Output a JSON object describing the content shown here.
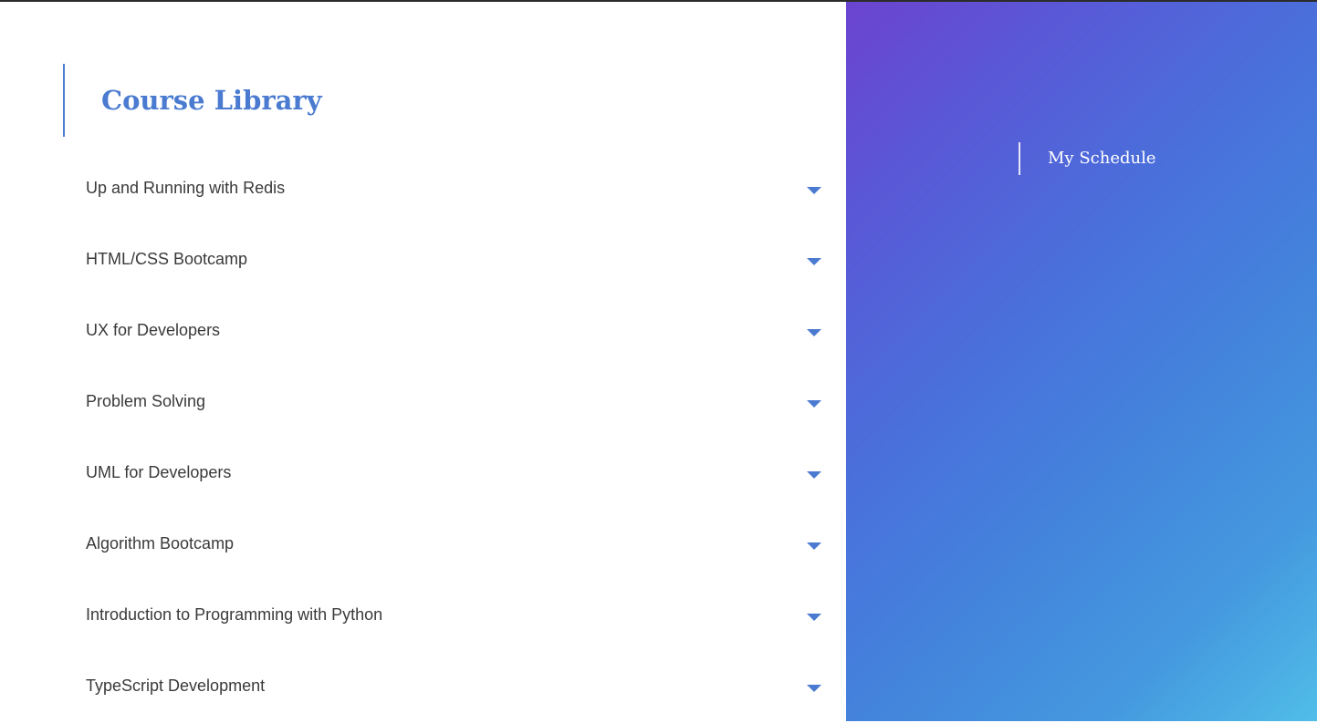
{
  "library": {
    "title": "Course Library",
    "courses": [
      {
        "label": "Up and Running with Redis"
      },
      {
        "label": "HTML/CSS Bootcamp"
      },
      {
        "label": "UX for Developers"
      },
      {
        "label": "Problem Solving"
      },
      {
        "label": "UML for Developers"
      },
      {
        "label": "Algorithm Bootcamp"
      },
      {
        "label": "Introduction to Programming with Python"
      },
      {
        "label": "TypeScript Development"
      }
    ]
  },
  "schedule": {
    "label": "My Schedule"
  },
  "icons": {
    "expand": "caret-down-icon"
  },
  "colors": {
    "accent": "#4a7bd0",
    "text": "#3a3a3a",
    "gradient_start": "#6c44cf",
    "gradient_end": "#50bde8"
  }
}
